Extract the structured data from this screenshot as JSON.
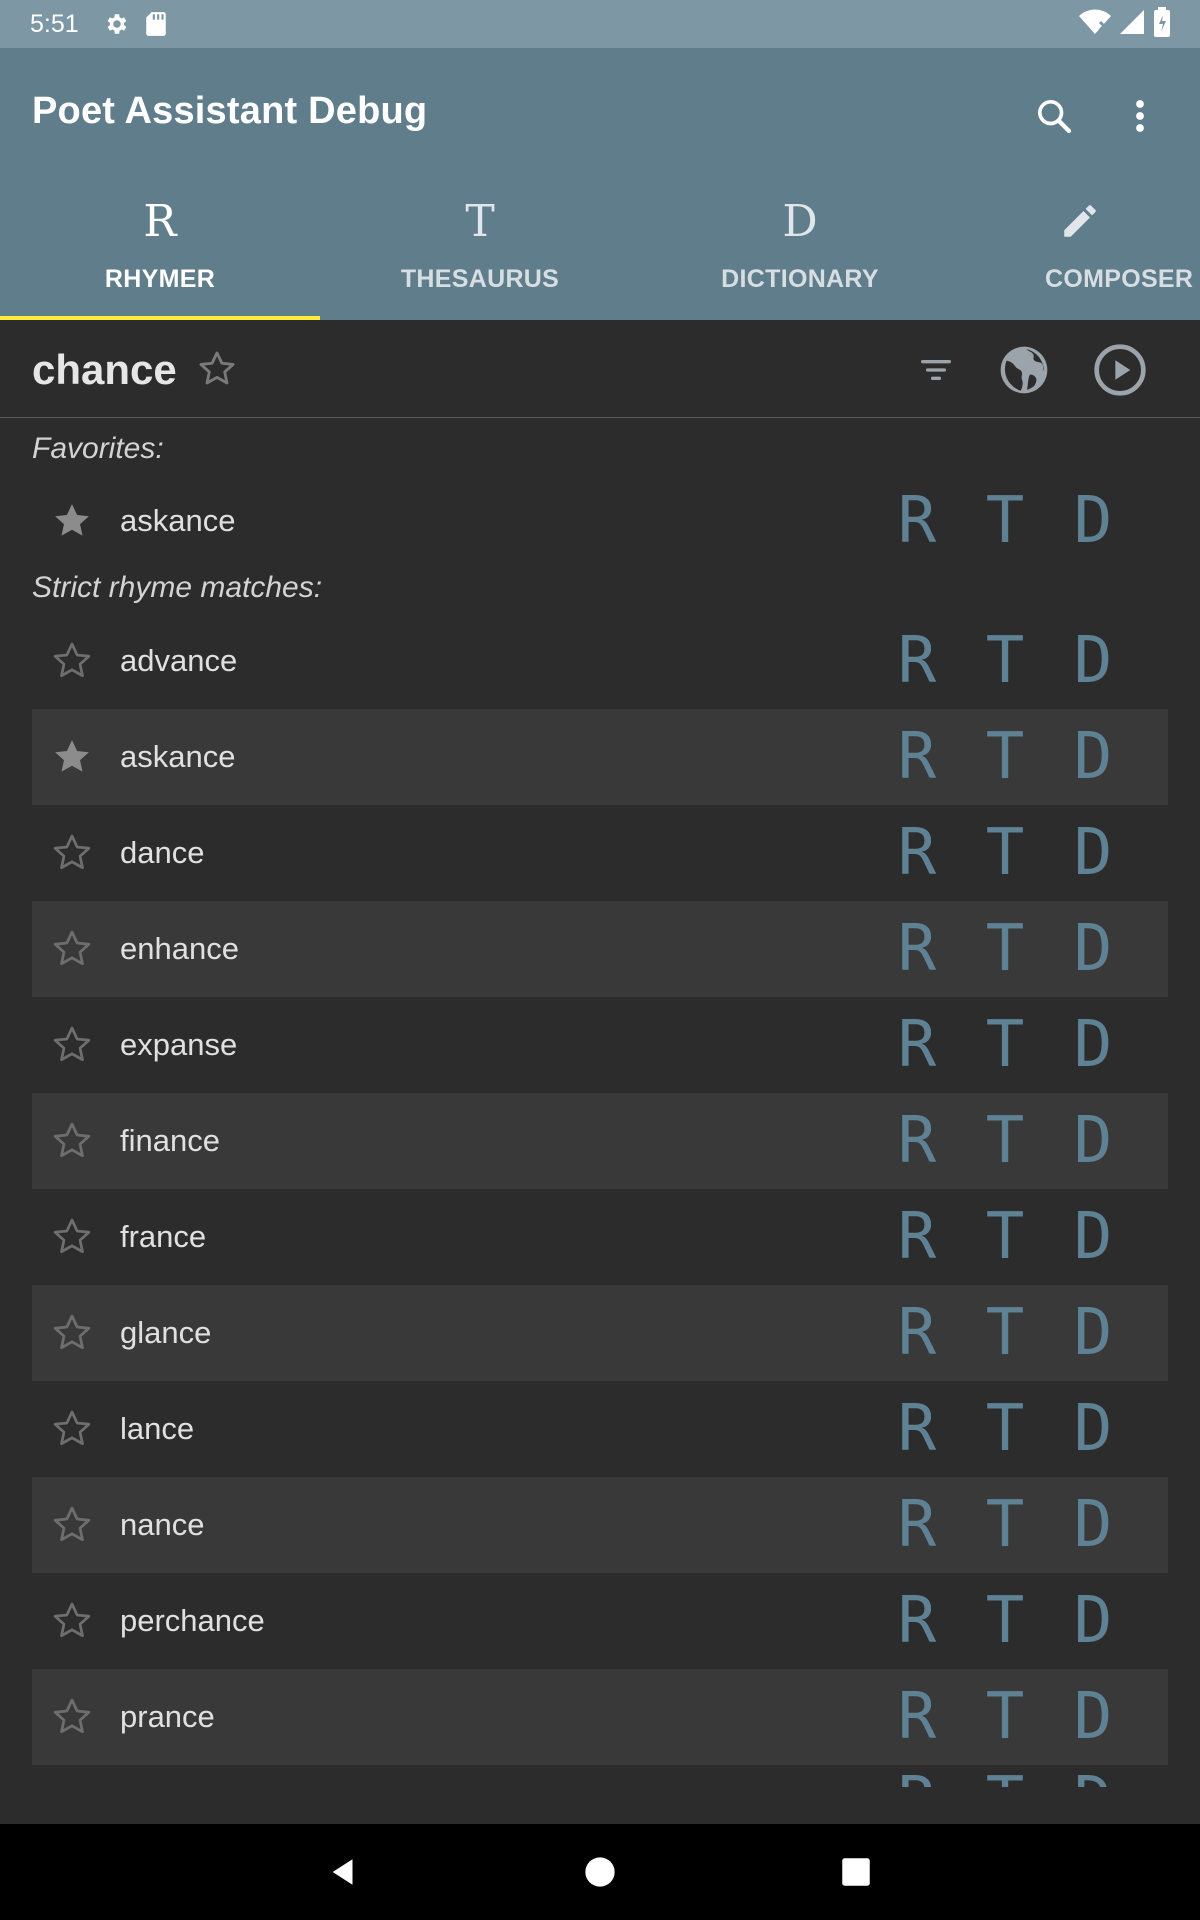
{
  "status_bar": {
    "time": "5:51",
    "icons_left": [
      "gear-icon",
      "sd-card-icon"
    ],
    "icons_right": [
      "wifi-off-icon",
      "signal-icon",
      "battery-icon"
    ]
  },
  "app_bar": {
    "title": "Poet Assistant Debug",
    "actions": [
      "search-icon",
      "more-vert-icon"
    ]
  },
  "tabs": [
    {
      "icon": "R",
      "label": "RHYMER",
      "active": true
    },
    {
      "icon": "T",
      "label": "THESAURUS",
      "active": false
    },
    {
      "icon": "D",
      "label": "DICTIONARY",
      "active": false
    },
    {
      "icon": "pencil-icon",
      "label": "COMPOSER",
      "active": false
    }
  ],
  "query": {
    "word": "chance",
    "favorite": false,
    "actions": [
      "filter-icon",
      "web-icon",
      "play-icon"
    ]
  },
  "sections": {
    "favorites_header": "Favorites:",
    "strict_header": "Strict rhyme matches:"
  },
  "rtd_labels": {
    "r": "R",
    "t": "T",
    "d": "D"
  },
  "favorites": [
    {
      "word": "askance",
      "starred": true
    }
  ],
  "strict_matches": [
    {
      "word": "advance",
      "starred": false
    },
    {
      "word": "askance",
      "starred": true
    },
    {
      "word": "dance",
      "starred": false
    },
    {
      "word": "enhance",
      "starred": false
    },
    {
      "word": "expanse",
      "starred": false
    },
    {
      "word": "finance",
      "starred": false
    },
    {
      "word": "france",
      "starred": false
    },
    {
      "word": "glance",
      "starred": false
    },
    {
      "word": "lance",
      "starred": false
    },
    {
      "word": "nance",
      "starred": false
    },
    {
      "word": "perchance",
      "starred": false
    },
    {
      "word": "prance",
      "starred": false
    }
  ],
  "colors": {
    "app_bar": "#607d8b",
    "status_bar": "#7d97a4",
    "tab_indicator": "#ffeb3b",
    "rtd_accent": "#5e8194",
    "background": "#2c2c2c"
  },
  "nav_bar": [
    "back-icon",
    "home-icon",
    "recents-icon"
  ]
}
